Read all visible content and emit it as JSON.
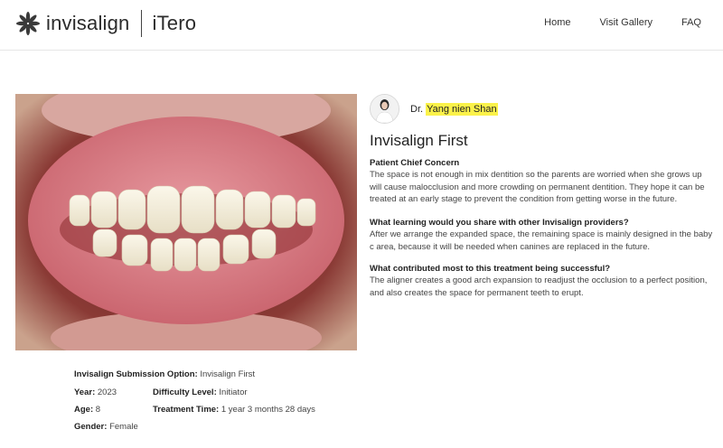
{
  "header": {
    "brand": "invisalign",
    "partner": "iTero",
    "nav": [
      "Home",
      "Visit Gallery",
      "FAQ"
    ]
  },
  "doctor": {
    "prefix": "Dr.",
    "name": "Yang nien Shan"
  },
  "case": {
    "title": "Invisalign First",
    "sections": [
      {
        "heading": "Patient Chief Concern",
        "body": "The space is not enough in mix dentition so the parents are worried when she grows up will cause malocclusion and more crowding on permanent dentition. They hope it can be treated at an early stage to prevent the condition from getting worse in the future."
      },
      {
        "heading": "What learning would you share with other Invisalign providers?",
        "body": "After we arrange the expanded space, the remaining space is mainly designed in the baby c area, because it will be needed when canines are replaced in the future."
      },
      {
        "heading": "What contributed most to this treatment being successful?",
        "body": "The aligner creates a good arch expansion to readjust the occlusion to a perfect position, and also creates the space for permanent teeth to erupt."
      }
    ]
  },
  "details": {
    "submission_label": "Invisalign Submission Option:",
    "submission_value": "Invisalign First",
    "year_label": "Year:",
    "year_value": "2023",
    "difficulty_label": "Difficulty Level:",
    "difficulty_value": "Initiator",
    "age_label": "Age:",
    "age_value": "8",
    "treatment_label": "Treatment Time:",
    "treatment_value": "1 year 3 months 28 days",
    "gender_label": "Gender:",
    "gender_value": "Female"
  },
  "colors": {
    "highlight": "#fbf24a",
    "border": "#e6e6e6"
  },
  "icons": {
    "logo": "invisalign-star-icon"
  }
}
